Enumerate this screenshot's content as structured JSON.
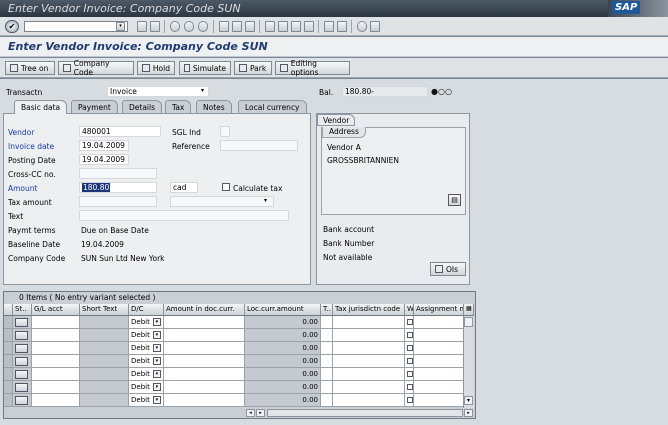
{
  "window": {
    "title": "Enter Vendor Invoice: Company Code SUN",
    "brand": "SAP"
  },
  "app": {
    "title": "Enter Vendor Invoice: Company Code SUN"
  },
  "app_toolbar": [
    "Tree on",
    "Company Code",
    "Hold",
    "Simulate",
    "Park",
    "Editing options"
  ],
  "header": {
    "transaction_label": "Transactn",
    "transaction_value": "Invoice",
    "balance_label": "Bal.",
    "balance_value": "180.80-"
  },
  "tabs": [
    "Basic data",
    "Payment",
    "Details",
    "Tax",
    "Notes",
    "Local currency"
  ],
  "form": {
    "vendor_label": "Vendor",
    "vendor_value": "480001",
    "sgl_label": "SGL Ind",
    "invoice_date_label": "Invoice date",
    "invoice_date_value": "19.04.2009",
    "reference_label": "Reference",
    "posting_date_label": "Posting Date",
    "posting_date_value": "19.04.2009",
    "crosscc_label": "Cross-CC no.",
    "amount_label": "Amount",
    "amount_value": "180.80",
    "currency_value": "cad",
    "calc_tax_label": "Calculate tax",
    "tax_amount_label": "Tax amount",
    "text_label": "Text",
    "paymt_terms_label": "Paymt terms",
    "paymt_terms_value": "Due on Base Date",
    "baseline_label": "Baseline Date",
    "baseline_value": "19.04.2009",
    "company_code_label": "Company Code",
    "company_code_value": "SUN Sun Ltd New York"
  },
  "vendor_panel": {
    "tab": "Vendor",
    "address_tab": "Address",
    "name": "Vendor A",
    "country": "GROSSBRITANNIEN",
    "bank_account_label": "Bank account",
    "bank_number_label": "Bank Number",
    "not_available": "Not available",
    "ois_button": "OIs"
  },
  "items": {
    "caption": "0 Items ( No entry variant selected )",
    "columns": [
      "St..",
      "G/L acct",
      "Short Text",
      "D/C",
      "Amount in doc.curr.",
      "Loc.curr.amount",
      "T..",
      "Tax jurisdictn code",
      "W..",
      "Assignment n"
    ],
    "rows": [
      {
        "dc": "Debit",
        "loc": "0.00"
      },
      {
        "dc": "Debit",
        "loc": "0.00"
      },
      {
        "dc": "Debit",
        "loc": "0.00"
      },
      {
        "dc": "Debit",
        "loc": "0.00"
      },
      {
        "dc": "Debit",
        "loc": "0.00"
      },
      {
        "dc": "Debit",
        "loc": "0.00"
      },
      {
        "dc": "Debit",
        "loc": "0.00"
      }
    ]
  }
}
